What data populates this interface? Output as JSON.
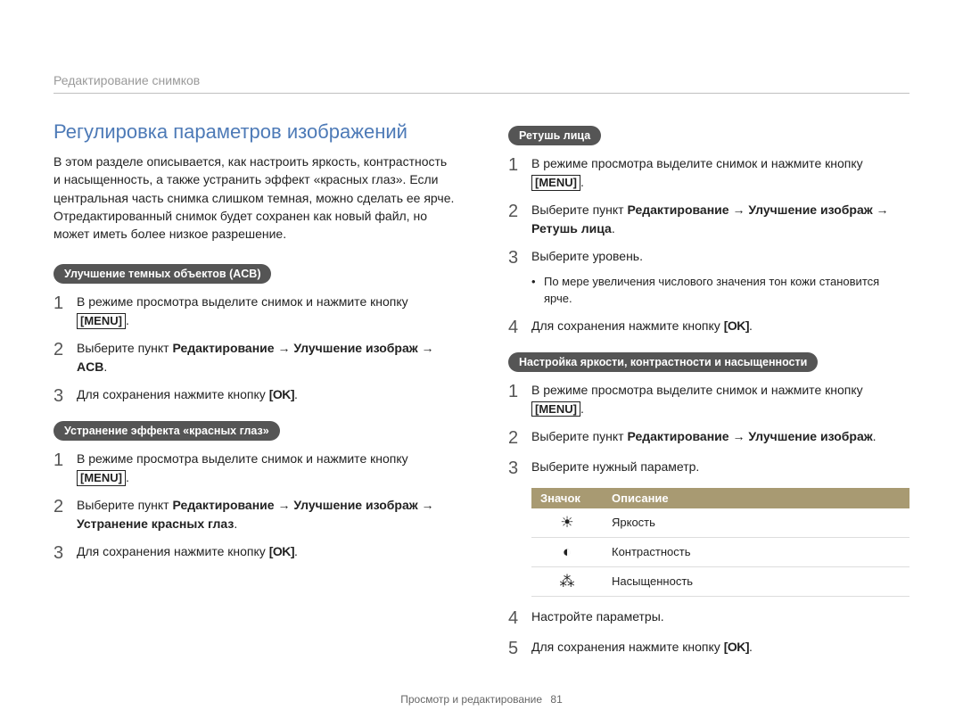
{
  "header": {
    "breadcrumb": "Редактирование снимков"
  },
  "section_title": "Регулировка параметров изображений",
  "intro": "В этом разделе описывается, как настроить яркость, контрастность и насыщенность, а также устранить эффект «красных глаз». Если центральная часть снимка слишком темная, можно сделать ее ярче. Отредактированный снимок будет сохранен как новый файл, но может иметь более низкое разрешение.",
  "buttons": {
    "menu": "MENU",
    "ok": "OK"
  },
  "acb": {
    "pill": "Улучшение темных объектов (ACB)",
    "steps": [
      {
        "n": "1",
        "pre": "В режиме просмотра выделите снимок и нажмите кнопку ",
        "btn": "menu",
        "post": "."
      },
      {
        "n": "2",
        "pre": "Выберите пункт ",
        "bold": "Редактирование → Улучшение изображ → ACB",
        "post": "."
      },
      {
        "n": "3",
        "pre": "Для сохранения нажмите кнопку ",
        "btn": "ok",
        "post": "."
      }
    ]
  },
  "redeye": {
    "pill": "Устранение эффекта «красных глаз»",
    "steps": [
      {
        "n": "1",
        "pre": "В режиме просмотра выделите снимок и нажмите кнопку ",
        "btn": "menu",
        "post": "."
      },
      {
        "n": "2",
        "pre": "Выберите пункт ",
        "bold": "Редактирование → Улучшение изображ → Устранение красных глаз",
        "post": "."
      },
      {
        "n": "3",
        "pre": "Для сохранения нажмите кнопку ",
        "btn": "ok",
        "post": "."
      }
    ]
  },
  "face": {
    "pill": "Ретушь лица",
    "steps": [
      {
        "n": "1",
        "pre": "В режиме просмотра выделите снимок и нажмите кнопку ",
        "btn": "menu",
        "post": "."
      },
      {
        "n": "2",
        "pre": "Выберите пункт ",
        "bold": "Редактирование → Улучшение изображ → Ретушь лица",
        "post": "."
      },
      {
        "n": "3",
        "pre": "Выберите уровень.",
        "bullets": [
          "По мере увеличения числового значения тон кожи становится ярче."
        ]
      },
      {
        "n": "4",
        "pre": "Для сохранения нажмите кнопку ",
        "btn": "ok",
        "post": "."
      }
    ]
  },
  "bcs": {
    "pill": "Настройка яркости, контрастности и насыщенности",
    "table_headers": {
      "icon": "Значок",
      "desc": "Описание"
    },
    "table_rows": [
      {
        "icon": "brightness-icon",
        "glyph": "☀",
        "desc": "Яркость"
      },
      {
        "icon": "contrast-icon",
        "glyph": "◐",
        "desc": "Контрастность"
      },
      {
        "icon": "saturation-icon",
        "glyph": "⁂",
        "desc": "Насыщенность"
      }
    ],
    "steps_before": [
      {
        "n": "1",
        "pre": "В режиме просмотра выделите снимок и нажмите кнопку ",
        "btn": "menu",
        "post": "."
      },
      {
        "n": "2",
        "pre": "Выберите пункт ",
        "bold": "Редактирование → Улучшение изображ",
        "post": "."
      },
      {
        "n": "3",
        "pre": "Выберите нужный параметр."
      }
    ],
    "steps_after": [
      {
        "n": "4",
        "pre": "Настройте параметры."
      },
      {
        "n": "5",
        "pre": "Для сохранения нажмите кнопку ",
        "btn": "ok",
        "post": "."
      }
    ]
  },
  "footer": {
    "section": "Просмотр и редактирование",
    "page": "81"
  }
}
